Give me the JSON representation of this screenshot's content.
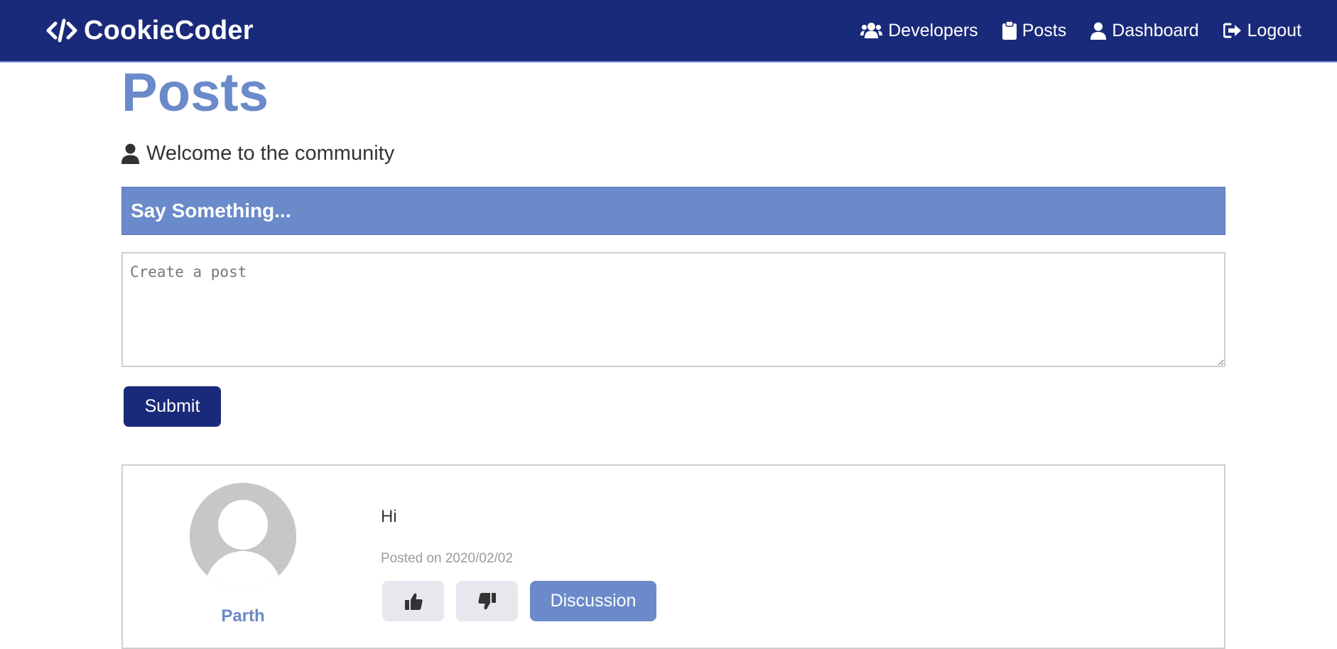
{
  "navbar": {
    "brand": "CookieCoder",
    "links": [
      {
        "label": "Developers",
        "icon": "users-icon"
      },
      {
        "label": "Posts",
        "icon": "clipboard-icon"
      },
      {
        "label": "Dashboard",
        "icon": "user-icon"
      },
      {
        "label": "Logout",
        "icon": "sign-out-icon"
      }
    ]
  },
  "page": {
    "title": "Posts",
    "lead": "Welcome to the community"
  },
  "post_form": {
    "header": "Say Something...",
    "placeholder": "Create a post",
    "value": "",
    "submit_label": "Submit"
  },
  "posts": [
    {
      "author": "Parth",
      "text": "Hi",
      "date": "Posted on 2020/02/02",
      "discussion_label": "Discussion"
    }
  ],
  "colors": {
    "navbar": "#1a2a7a",
    "accent": "#6a8ac9",
    "light_button": "#e6e8ee"
  }
}
